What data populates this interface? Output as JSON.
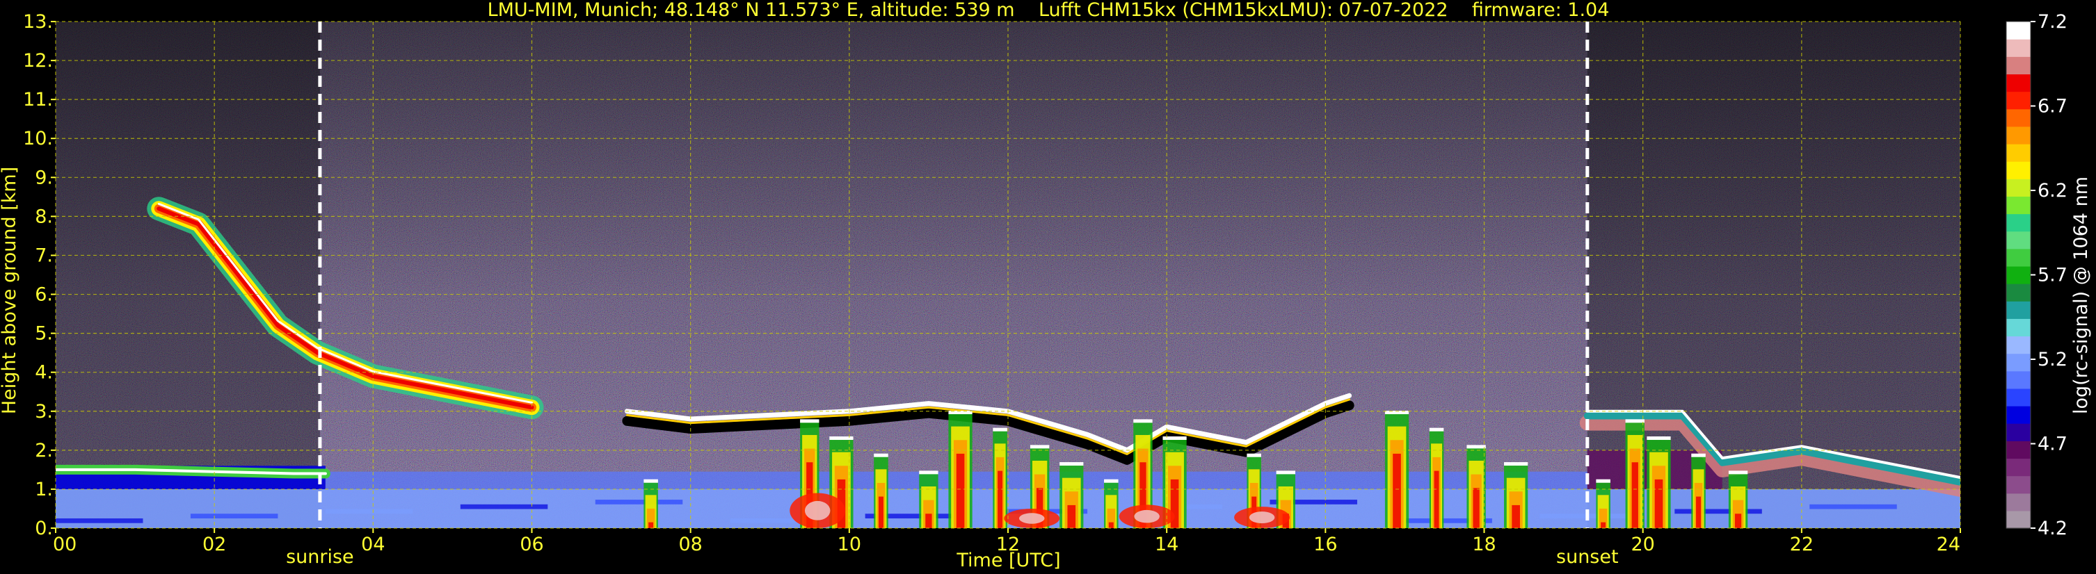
{
  "chart_data": {
    "type": "heatmap",
    "title": "LMU-MIM, Munich; 48.148° N 11.573° E, altitude: 539 m    Lufft CHM15kx (CHM15kxLMU): 07-07-2022    firmware: 1.04",
    "xlabel": "Time [UTC]",
    "ylabel": "Height above ground [km]",
    "xlim": [
      0,
      24
    ],
    "ylim": [
      0,
      13
    ],
    "x_ticks": [
      0,
      2,
      4,
      6,
      8,
      10,
      12,
      14,
      16,
      18,
      20,
      22,
      24
    ],
    "x_tick_labels": [
      "00",
      "02",
      "04",
      "06",
      "08",
      "10",
      "12",
      "14",
      "16",
      "18",
      "20",
      "22",
      "24"
    ],
    "y_ticks": [
      0,
      1,
      2,
      3,
      4,
      5,
      6,
      7,
      8,
      9,
      10,
      11,
      12,
      13
    ],
    "y_tick_labels": [
      "0.",
      "1.",
      "2.",
      "3.",
      "4.",
      "5.",
      "6.",
      "7.",
      "8.",
      "9.",
      "10.",
      "11.",
      "12.",
      "13."
    ],
    "grid": true,
    "markers": [
      {
        "label": "sunrise",
        "x": 3.33
      },
      {
        "label": "sunset",
        "x": 19.3
      }
    ],
    "colorbar": {
      "label": "log(rc-signal) @ 1064 nm",
      "min": 4.2,
      "max": 7.2,
      "ticks": [
        4.2,
        4.7,
        5.2,
        5.7,
        6.2,
        6.7,
        7.2
      ],
      "tick_labels": [
        "4.2",
        "4.7",
        "5.2",
        "5.7",
        "6.2",
        "6.7",
        "7.2"
      ],
      "colors": [
        "#a898a8",
        "#9c7a9c",
        "#8c4c8c",
        "#7a2a7a",
        "#600a60",
        "#2a00a0",
        "#0000e0",
        "#2a44ff",
        "#5a78ff",
        "#7a9cff",
        "#9ab8ff",
        "#66d8d8",
        "#20a0a0",
        "#1a8a40",
        "#10b010",
        "#40cc40",
        "#60dd80",
        "#2ad088",
        "#7ae830",
        "#c8f020",
        "#fff000",
        "#ffcc00",
        "#ff9900",
        "#ff6600",
        "#ff2000",
        "#ee0000",
        "#d88080",
        "#eebbbb",
        "#ffffff"
      ]
    },
    "features": [
      {
        "kind": "mixed-layer aerosol",
        "x_start": 0,
        "x_end": 24,
        "top_km": 1.0,
        "value": 5.2
      },
      {
        "kind": "residual layer",
        "x_start": 0,
        "x_end": 3.4,
        "top_km": 1.6,
        "value": 4.8
      },
      {
        "kind": "cloud top line",
        "points": [
          [
            0,
            1.5
          ],
          [
            1,
            1.5
          ],
          [
            2,
            1.45
          ],
          [
            3,
            1.4
          ],
          [
            3.4,
            1.4
          ]
        ]
      },
      {
        "kind": "descending cirrus",
        "points": [
          [
            1.3,
            8.2
          ],
          [
            1.8,
            7.8
          ],
          [
            2.3,
            6.5
          ],
          [
            2.8,
            5.2
          ],
          [
            3.3,
            4.5
          ],
          [
            4,
            3.9
          ],
          [
            5,
            3.5
          ],
          [
            6,
            3.1
          ]
        ]
      },
      {
        "kind": "cloud layer",
        "points": [
          [
            7.2,
            3.0
          ],
          [
            8,
            2.8
          ],
          [
            9,
            2.9
          ],
          [
            10,
            3.0
          ],
          [
            11,
            3.2
          ],
          [
            12,
            3.0
          ],
          [
            13,
            2.4
          ],
          [
            13.5,
            2.0
          ],
          [
            14,
            2.6
          ],
          [
            15,
            2.2
          ],
          [
            16,
            3.2
          ],
          [
            16.3,
            3.4
          ]
        ]
      },
      {
        "kind": "evening layer",
        "points": [
          [
            19.3,
            3.0
          ],
          [
            20.5,
            3.0
          ],
          [
            21,
            1.8
          ],
          [
            22,
            2.1
          ],
          [
            23,
            1.7
          ],
          [
            24,
            1.3
          ]
        ]
      },
      {
        "kind": "convective plumes",
        "x": [
          7.5,
          9.5,
          9.9,
          10.4,
          11.0,
          11.4,
          11.9,
          12.4,
          12.8,
          13.3,
          13.7,
          14.1,
          15.1,
          15.5,
          16.9,
          17.4,
          17.9,
          18.4,
          19.5,
          19.9,
          20.2,
          20.7,
          21.2
        ]
      }
    ]
  }
}
